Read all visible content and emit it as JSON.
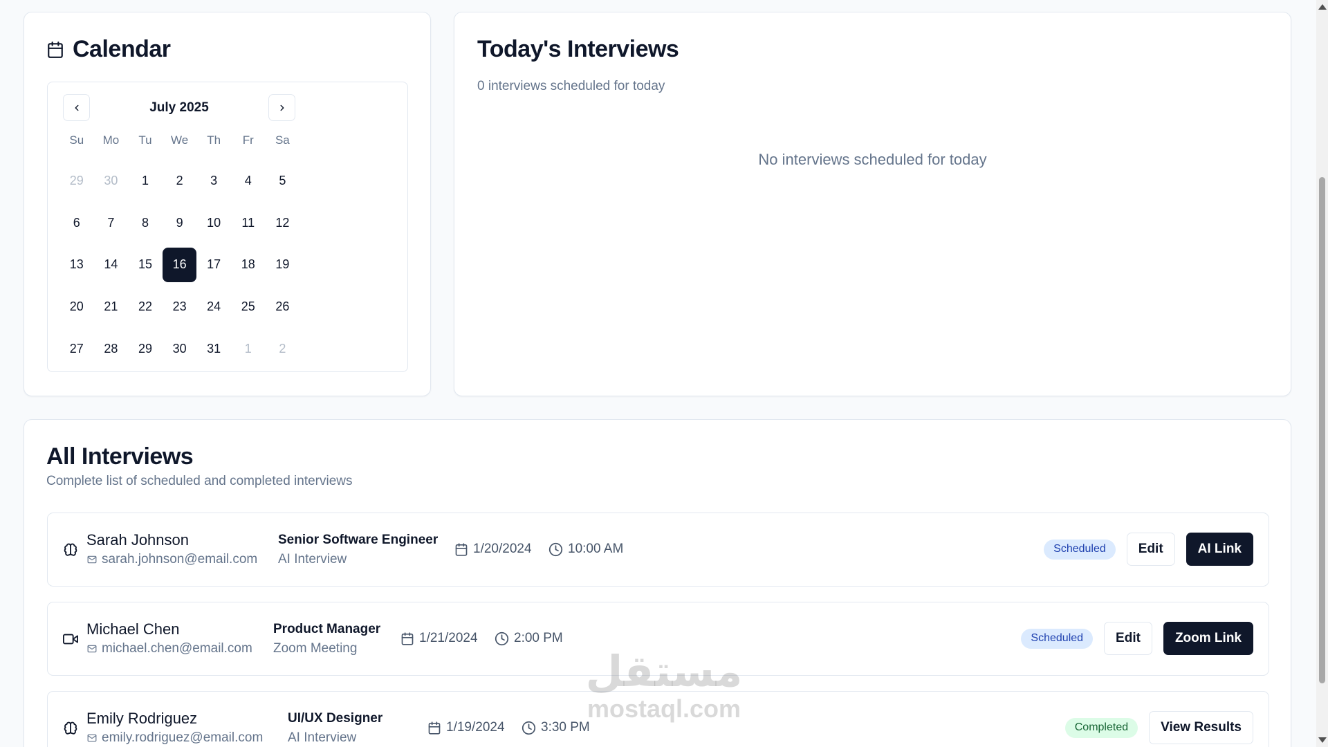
{
  "calendar": {
    "title": "Calendar",
    "month_label": "July 2025",
    "weekdays": [
      "Su",
      "Mo",
      "Tu",
      "We",
      "Th",
      "Fr",
      "Sa"
    ],
    "weeks": [
      [
        {
          "d": "29",
          "out": true
        },
        {
          "d": "30",
          "out": true
        },
        {
          "d": "1"
        },
        {
          "d": "2"
        },
        {
          "d": "3"
        },
        {
          "d": "4"
        },
        {
          "d": "5"
        }
      ],
      [
        {
          "d": "6"
        },
        {
          "d": "7"
        },
        {
          "d": "8"
        },
        {
          "d": "9"
        },
        {
          "d": "10"
        },
        {
          "d": "11"
        },
        {
          "d": "12"
        }
      ],
      [
        {
          "d": "13"
        },
        {
          "d": "14"
        },
        {
          "d": "15"
        },
        {
          "d": "16",
          "selected": true
        },
        {
          "d": "17"
        },
        {
          "d": "18"
        },
        {
          "d": "19"
        }
      ],
      [
        {
          "d": "20"
        },
        {
          "d": "21"
        },
        {
          "d": "22"
        },
        {
          "d": "23"
        },
        {
          "d": "24"
        },
        {
          "d": "25"
        },
        {
          "d": "26"
        }
      ],
      [
        {
          "d": "27"
        },
        {
          "d": "28"
        },
        {
          "d": "29"
        },
        {
          "d": "30"
        },
        {
          "d": "31"
        },
        {
          "d": "1",
          "out": true
        },
        {
          "d": "2",
          "out": true
        }
      ]
    ]
  },
  "today": {
    "title": "Today's Interviews",
    "subtitle": "0 interviews scheduled for today",
    "empty_message": "No interviews scheduled for today"
  },
  "all": {
    "title": "All Interviews",
    "subtitle": "Complete list of scheduled and completed interviews",
    "rows": [
      {
        "icon": "brain-icon",
        "name": "Sarah Johnson",
        "email": "sarah.johnson@email.com",
        "role": "Senior Software Engineer",
        "type": "AI Interview",
        "date": "1/20/2024",
        "time": "10:00 AM",
        "status": "Scheduled",
        "edit_label": "Edit",
        "primary_label": "AI Link"
      },
      {
        "icon": "video-icon",
        "name": "Michael Chen",
        "email": "michael.chen@email.com",
        "role": "Product Manager",
        "type": "Zoom Meeting",
        "date": "1/21/2024",
        "time": "2:00 PM",
        "status": "Scheduled",
        "edit_label": "Edit",
        "primary_label": "Zoom Link"
      },
      {
        "icon": "brain-icon",
        "name": "Emily Rodriguez",
        "email": "emily.rodriguez@email.com",
        "role": "UI/UX Designer",
        "type": "AI Interview",
        "date": "1/19/2024",
        "time": "3:30 PM",
        "status": "Completed",
        "primary_label": "View Results"
      }
    ]
  },
  "watermark": {
    "arabic": "مستقل",
    "latin": "mostaql.com"
  },
  "colors": {
    "primary": "#0f172a",
    "muted": "#64748b",
    "border": "#e2e8f0",
    "scheduled_bg": "#dbeafe",
    "completed_bg": "#dcfce7"
  }
}
